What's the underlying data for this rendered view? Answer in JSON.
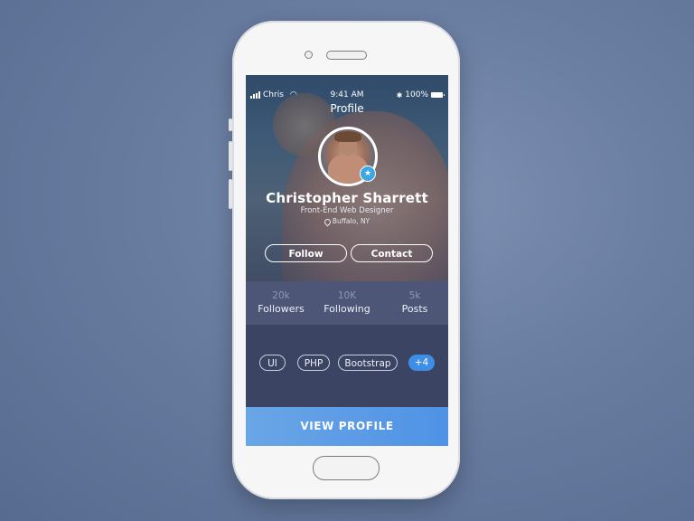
{
  "status_bar": {
    "carrier": "Chris",
    "time": "9:41 AM",
    "battery": "100%"
  },
  "header": {
    "title": "Profile"
  },
  "profile": {
    "name": "Christopher Sharrett",
    "role": "Front-End Web Designer",
    "location": "Buffalo, NY",
    "badge_icon": "star-icon"
  },
  "actions": {
    "follow_label": "Follow",
    "contact_label": "Contact"
  },
  "stats": [
    {
      "value": "20k",
      "label": "Followers"
    },
    {
      "value": "10K",
      "label": "Following"
    },
    {
      "value": "5k",
      "label": "Posts"
    }
  ],
  "tags": [
    "UI",
    "PHP",
    "Bootstrap",
    "+4"
  ],
  "cta": {
    "label": "VIEW PROFILE"
  },
  "colors": {
    "accent": "#3f8ee6",
    "badge": "#3ea7e2",
    "panel": "#3b4563",
    "stats_bg": "#4d5676"
  }
}
